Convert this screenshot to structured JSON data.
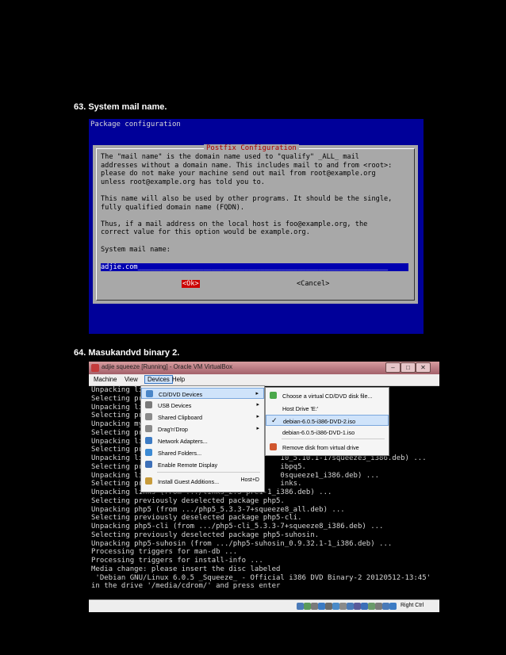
{
  "headings": {
    "step63": "63. System mail name.",
    "step64": "64. Masukandvd binary 2."
  },
  "installer": {
    "header": "Package configuration",
    "dialog_title": "Postfix Configuration",
    "lines": [
      "The \"mail name\" is the domain name used to \"qualify\" _ALL_ mail",
      "addresses without a domain name. This includes mail to and from <root>:",
      "please do not make your machine send out mail from root@example.org",
      "unless root@example.org has told you to.",
      "",
      "This name will also be used by other programs. It should be the single,",
      "fully qualified domain name (FQDN).",
      "",
      "Thus, if a mail address on the local host is foo@example.org, the",
      "correct value for this option would be example.org.",
      "",
      "System mail name:"
    ],
    "field_value": "adjie.com_____________________________________________________________",
    "ok_label": "<Ok>",
    "cancel_label": "<Cancel>"
  },
  "virtualbox": {
    "window_title": "adjie squeeze [Running] - Oracle VM VirtualBox",
    "menu": {
      "machine": "Machine",
      "view": "View",
      "devices": "Devices",
      "help": "Help"
    },
    "devices_menu": [
      {
        "label": "CD/DVD Devices",
        "arrow": "▸",
        "icon_color": "#4a86c8"
      },
      {
        "label": "USB Devices",
        "arrow": "▸",
        "icon_color": "#7a7a7a"
      },
      {
        "label": "Shared Clipboard",
        "arrow": "▸",
        "icon_color": "#8a8a8a"
      },
      {
        "label": "Drag'n'Drop",
        "arrow": "▸",
        "icon_color": "#8a8a8a"
      },
      {
        "label": "Network Adapters...",
        "arrow": "",
        "icon_color": "#3c7bc4"
      },
      {
        "label": "Shared Folders...",
        "arrow": "",
        "icon_color": "#3c8ad4"
      },
      {
        "label": "Enable Remote Display",
        "arrow": "",
        "icon_color": "#3c6fb8"
      },
      {
        "label": "Install Guest Additions...",
        "arrow": "Host+D",
        "icon_color": "#c89b3a"
      }
    ],
    "cd_submenu": [
      {
        "label": "Choose a virtual CD/DVD disk file...",
        "check": "",
        "icon_color": "#4aa84a"
      },
      {
        "label": "Host Drive 'E:'",
        "check": "",
        "icon_color": ""
      },
      {
        "label": "debian-6.0.5-i386-DVD-2.iso",
        "check": "✓",
        "icon_color": ""
      },
      {
        "label": "debian-6.0.5-i386-DVD-1.iso",
        "check": "",
        "icon_color": ""
      },
      {
        "label": "Remove disk from virtual drive",
        "check": "",
        "icon_color": "#d0562e"
      }
    ],
    "console_lines": [
      "Unpacking li",
      "Selecting pr",
      "Unpacking li",
      "Selecting pr",
      "Unpacking my",
      "Selecting pr",
      "Unpacking li                                     .deb) ...",
      "Selecting pr",
      "Unpacking li                                10_5.10.1-17squeeze3_i386.deb) ...",
      "Selecting pr                                ibpq5.",
      "Unpacking li                                0squeeze1_i386.deb) ...",
      "Selecting pr                                inks.",
      "Unpacking links (from .../links_2.3~pre1-1_i386.deb) ...",
      "Selecting previously deselected package php5.",
      "Unpacking php5 (from .../php5_5.3.3-7+squeeze8_all.deb) ...",
      "Selecting previously deselected package php5-cli.",
      "Unpacking php5-cli (from .../php5-cli_5.3.3-7+squeeze8_i386.deb) ...",
      "Selecting previously deselected package php5-suhosin.",
      "Unpacking php5-suhosin (from .../php5-suhosin_0.9.32.1-1_i386.deb) ...",
      "Processing triggers for man-db ...",
      "Processing triggers for install-info ...",
      "Media change: please insert the disc labeled",
      " 'Debian GNU/Linux 6.0.5 _Squeeze_ - Official i386 DVD Binary-2 20120512-13:45'",
      "in the drive '/media/cdrom/' and press enter"
    ],
    "status_right": "Right Ctrl"
  }
}
